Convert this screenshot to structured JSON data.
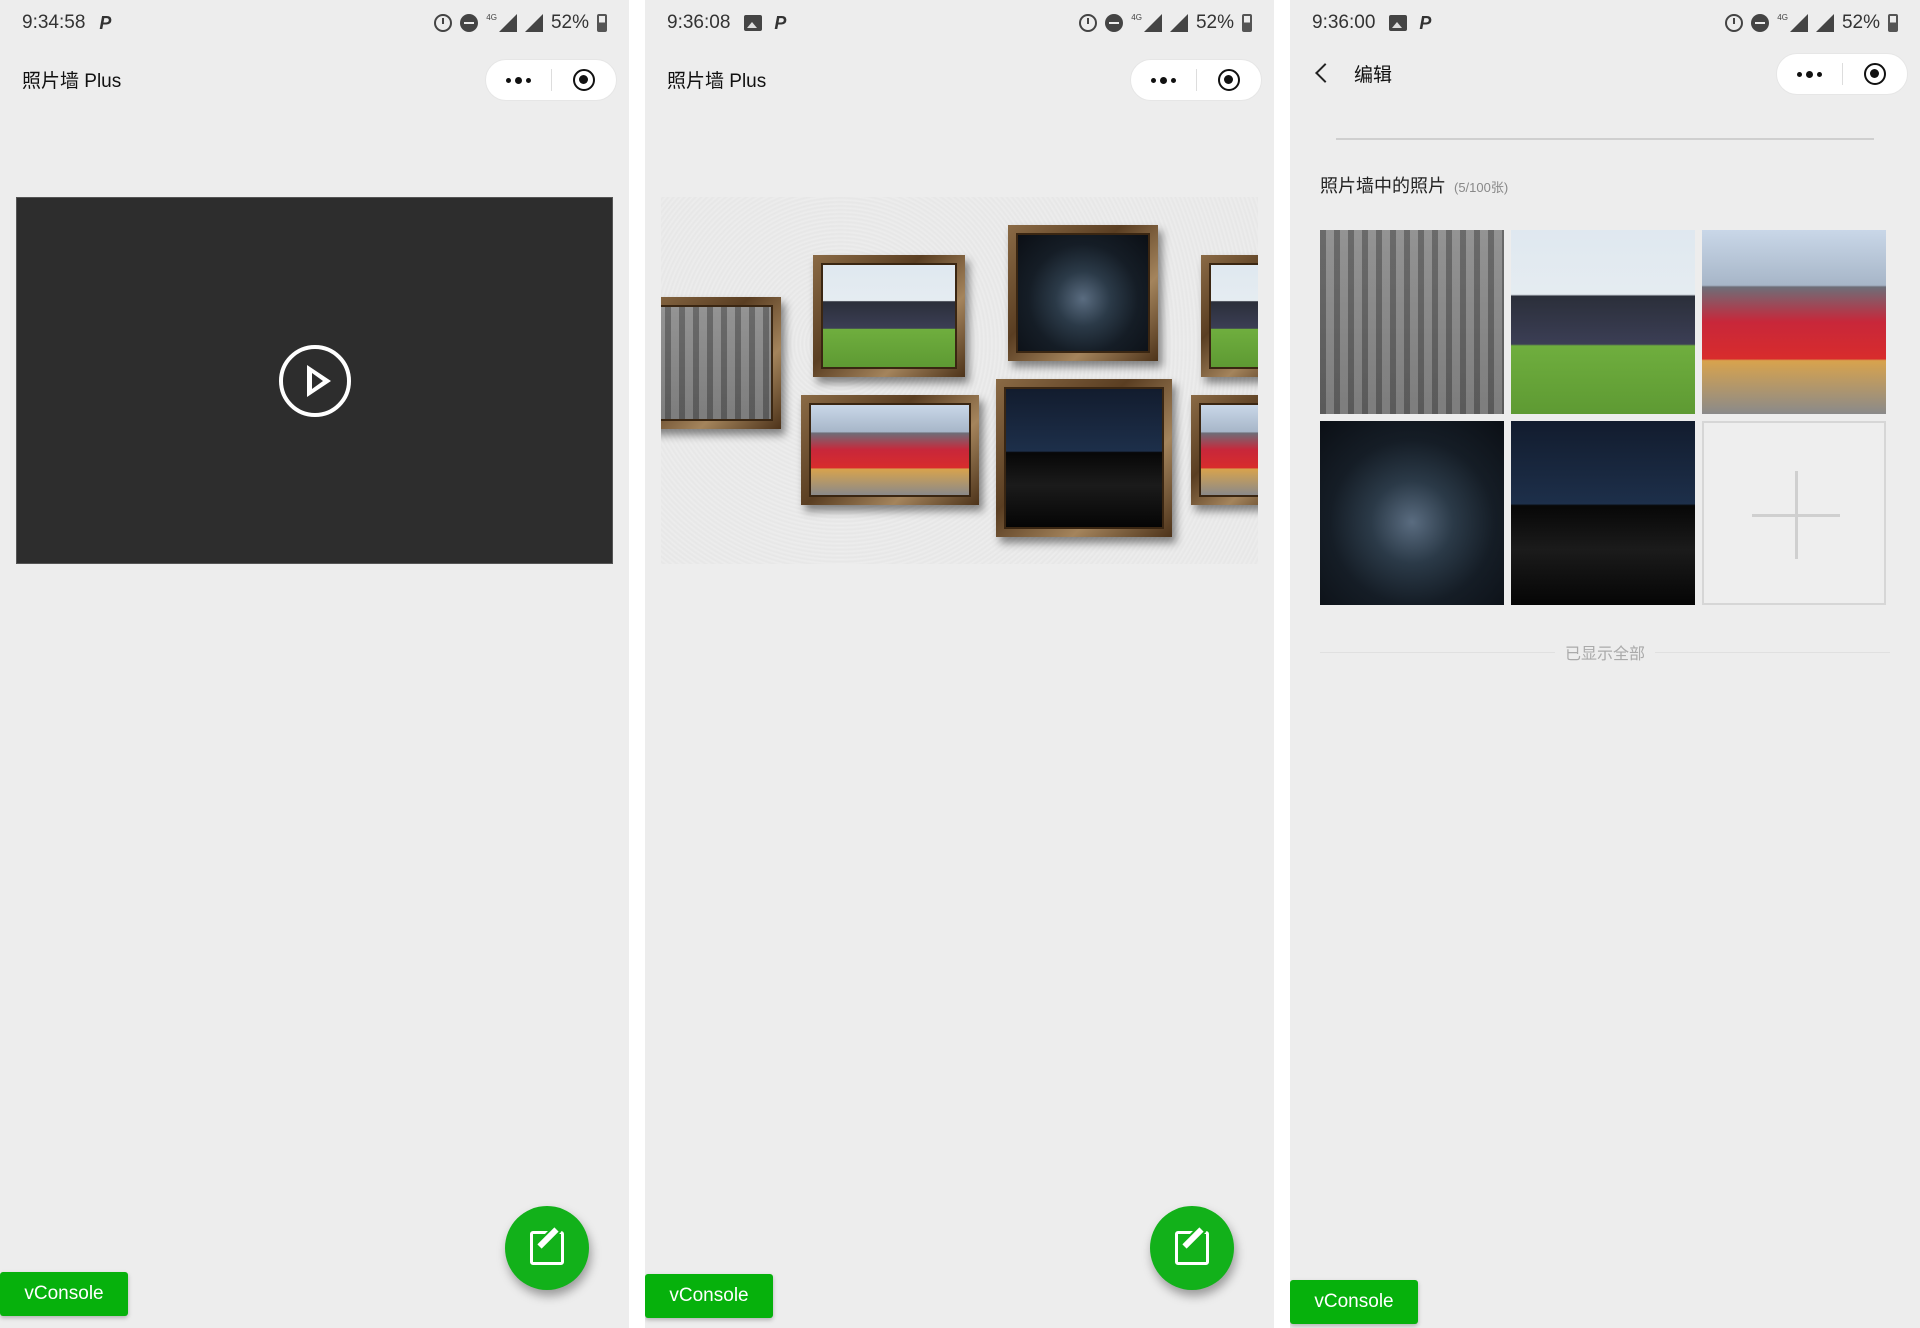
{
  "screens": [
    {
      "time": "9:34:58",
      "battery": "52%",
      "network": "4G",
      "title": "照片墙 Plus",
      "vconsole": "vConsole"
    },
    {
      "time": "9:36:08",
      "battery": "52%",
      "network": "4G",
      "title": "照片墙 Plus",
      "vconsole": "vConsole"
    },
    {
      "time": "9:36:00",
      "battery": "52%",
      "network": "4G",
      "title": "编辑",
      "section_title": "照片墙中的照片",
      "photo_count": "(5/100张)",
      "end_text": "已显示全部",
      "vconsole": "vConsole"
    }
  ],
  "icons": {
    "status_left": [
      "parking-icon",
      "image-icon"
    ],
    "status_right": [
      "alarm-icon",
      "do-not-disturb-icon",
      "signal-4g-icon",
      "signal-icon",
      "battery-icon"
    ],
    "capsule": [
      "more-icon",
      "close-miniprogram-icon"
    ],
    "fab": "edit-icon",
    "video": "play-icon",
    "add": "plus-icon",
    "back": "back-icon"
  },
  "colors": {
    "accent_green": "#12b11a",
    "vconsole_green": "#06b10c",
    "background": "#ededed",
    "video_background": "#2d2d2d"
  }
}
